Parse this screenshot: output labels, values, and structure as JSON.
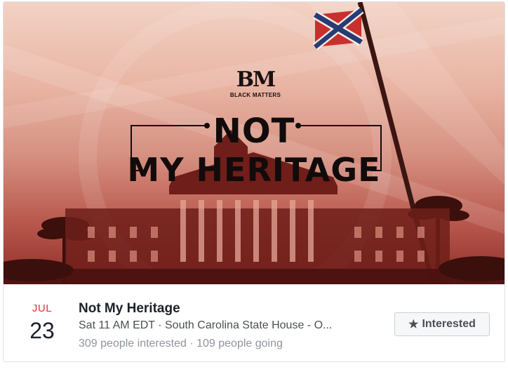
{
  "cover": {
    "logo_mark": "BM",
    "logo_text": "BLACK MATTERS",
    "headline_line1": "NOT",
    "headline_line2": "MY HERITAGE"
  },
  "event": {
    "month": "JUL",
    "day": "23",
    "title": "Not My Heritage",
    "meta": "Sat 11 AM EDT · South Carolina State House - O...",
    "stats": "309 people interested · 109 people going"
  },
  "actions": {
    "interested_label": "Interested",
    "interested_icon": "star-icon"
  },
  "colors": {
    "month_red": "#e0323b",
    "text_dark": "#1d2129",
    "text_muted": "#90949c"
  }
}
